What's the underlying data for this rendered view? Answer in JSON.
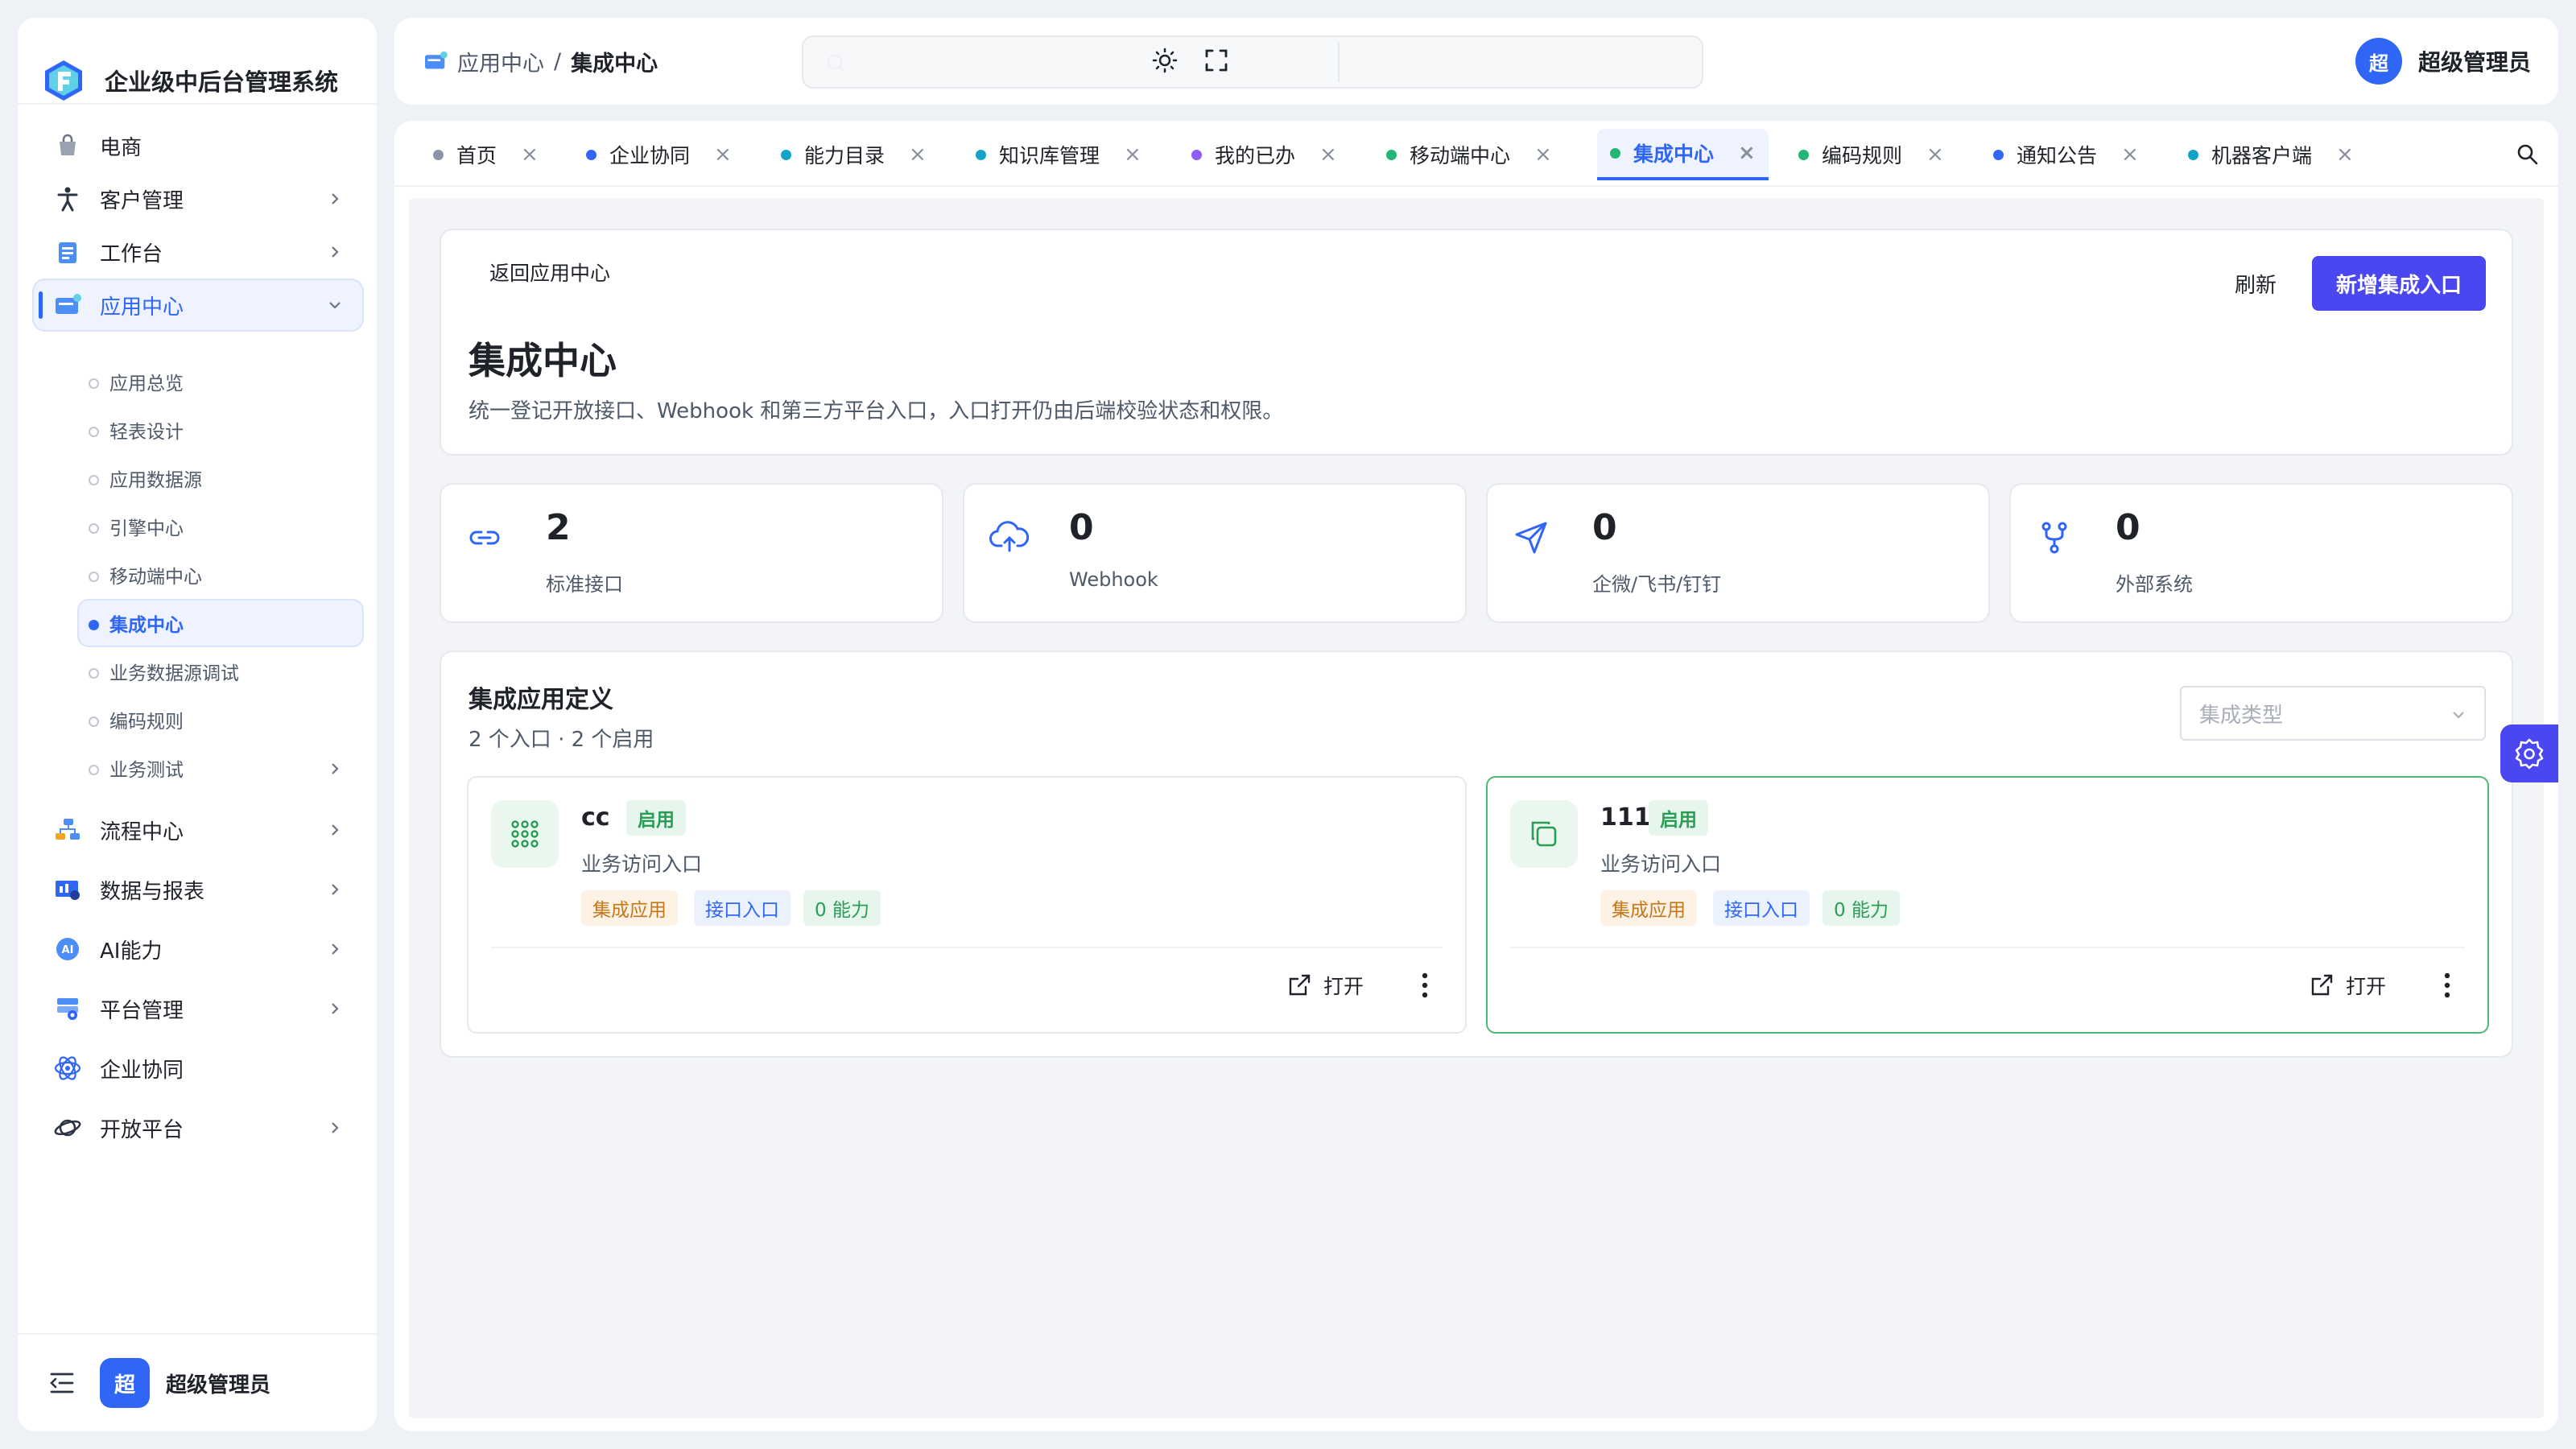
{
  "app": {
    "name": "企业级中后台管理系统"
  },
  "sidebar": {
    "items": [
      {
        "label": "电商",
        "icon": "shopping-bag-icon"
      },
      {
        "label": "客户管理",
        "icon": "person-icon"
      },
      {
        "label": "工作台",
        "icon": "clipboard-icon"
      },
      {
        "label": "应用中心",
        "icon": "app-center-icon",
        "expanded": true
      },
      {
        "label": "流程中心",
        "icon": "flow-icon"
      },
      {
        "label": "数据与报表",
        "icon": "report-icon"
      },
      {
        "label": "AI能力",
        "icon": "ai-icon"
      },
      {
        "label": "平台管理",
        "icon": "platform-icon"
      },
      {
        "label": "企业协同",
        "icon": "collab-icon"
      },
      {
        "label": "开放平台",
        "icon": "planet-icon"
      }
    ],
    "sub_items": [
      "应用总览",
      "轻表设计",
      "应用数据源",
      "引擎中心",
      "移动端中心",
      "集成中心",
      "业务数据源调试",
      "编码规则",
      "业务测试"
    ],
    "footer_user": "超级管理员",
    "footer_avatar": "超"
  },
  "header": {
    "breadcrumb": [
      "应用中心",
      "集成中心"
    ],
    "breadcrumb_sep": "/",
    "user_name": "超级管理员",
    "avatar": "超"
  },
  "tabs": [
    {
      "label": "首页",
      "color": "#8a94a6"
    },
    {
      "label": "企业协同",
      "color": "#2f66f6"
    },
    {
      "label": "能力目录",
      "color": "#14a3c7"
    },
    {
      "label": "知识库管理",
      "color": "#14a3c7"
    },
    {
      "label": "我的已办",
      "color": "#8b5cf6"
    },
    {
      "label": "移动端中心",
      "color": "#22b573"
    },
    {
      "label": "集成中心",
      "color": "#22b573",
      "active": true
    },
    {
      "label": "编码规则",
      "color": "#22b573"
    },
    {
      "label": "通知公告",
      "color": "#2f66f6"
    },
    {
      "label": "机器客户端",
      "color": "#14a3c7"
    }
  ],
  "tab_close": "×",
  "page": {
    "back_link": "返回应用中心",
    "title": "集成中心",
    "description": "统一登记开放接口、Webhook 和第三方平台入口，入口打开仍由后端校验状态和权限。",
    "refresh": "刷新",
    "add_button": "新增集成入口"
  },
  "stats": [
    {
      "value": "2",
      "label": "标准接口",
      "icon": "link-icon"
    },
    {
      "value": "0",
      "label": "Webhook",
      "icon": "cloud-upload-icon"
    },
    {
      "value": "0",
      "label": "企微/飞书/钉钉",
      "icon": "send-icon"
    },
    {
      "value": "0",
      "label": "外部系统",
      "icon": "branch-icon"
    }
  ],
  "section": {
    "title": "集成应用定义",
    "subtitle": "2 个入口 · 2 个启用",
    "filter_placeholder": "集成类型"
  },
  "apps": [
    {
      "name": "cc",
      "status": "启用",
      "subtitle": "业务访问入口",
      "tags": [
        "集成应用",
        "接口入口",
        "0 能力"
      ],
      "open": "打开",
      "icon": "grid-dots-icon"
    },
    {
      "name": "111",
      "status": "启用",
      "subtitle": "业务访问入口",
      "tags": [
        "集成应用",
        "接口入口",
        "0 能力"
      ],
      "open": "打开",
      "icon": "copy-icon"
    }
  ],
  "colors": {
    "primary": "#2f66f6",
    "accent_button": "#4b47f0",
    "success": "#2a9d55"
  }
}
